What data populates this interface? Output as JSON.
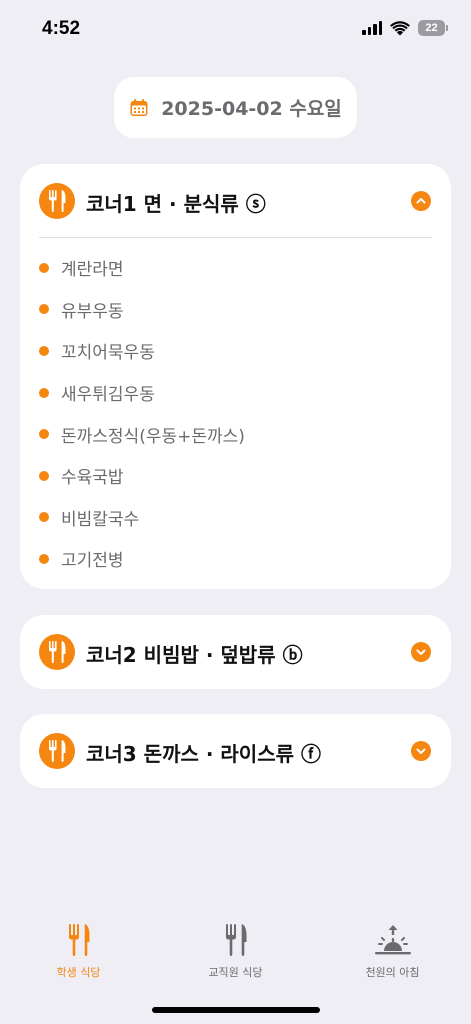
{
  "status": {
    "time": "4:52",
    "battery": "22"
  },
  "date": "2025-04-02 수요일",
  "colors": {
    "accent": "#f5860f",
    "background": "#efeef4",
    "muted": "#6b6b6f"
  },
  "corners": [
    {
      "title": "코너1 면 · 분식류 ⓢ",
      "expanded": true,
      "items": [
        "계란라면",
        "유부우동",
        "꼬치어묵우동",
        "새우튀김우동",
        "돈까스정식(우동+돈까스)",
        "수육국밥",
        "비빔칼국수",
        "고기전병"
      ]
    },
    {
      "title": "코너2 비빔밥 · 덮밥류 ⓑ",
      "expanded": false,
      "items": []
    },
    {
      "title": "코너3 돈까스 · 라이스류 ⓕ",
      "expanded": false,
      "items": []
    }
  ],
  "tabs": [
    {
      "label": "학생 식당",
      "icon": "fork-knife-icon",
      "active": true
    },
    {
      "label": "교직원 식당",
      "icon": "fork-knife-icon",
      "active": false
    },
    {
      "label": "천원의 아침",
      "icon": "sunrise-icon",
      "active": false
    }
  ]
}
